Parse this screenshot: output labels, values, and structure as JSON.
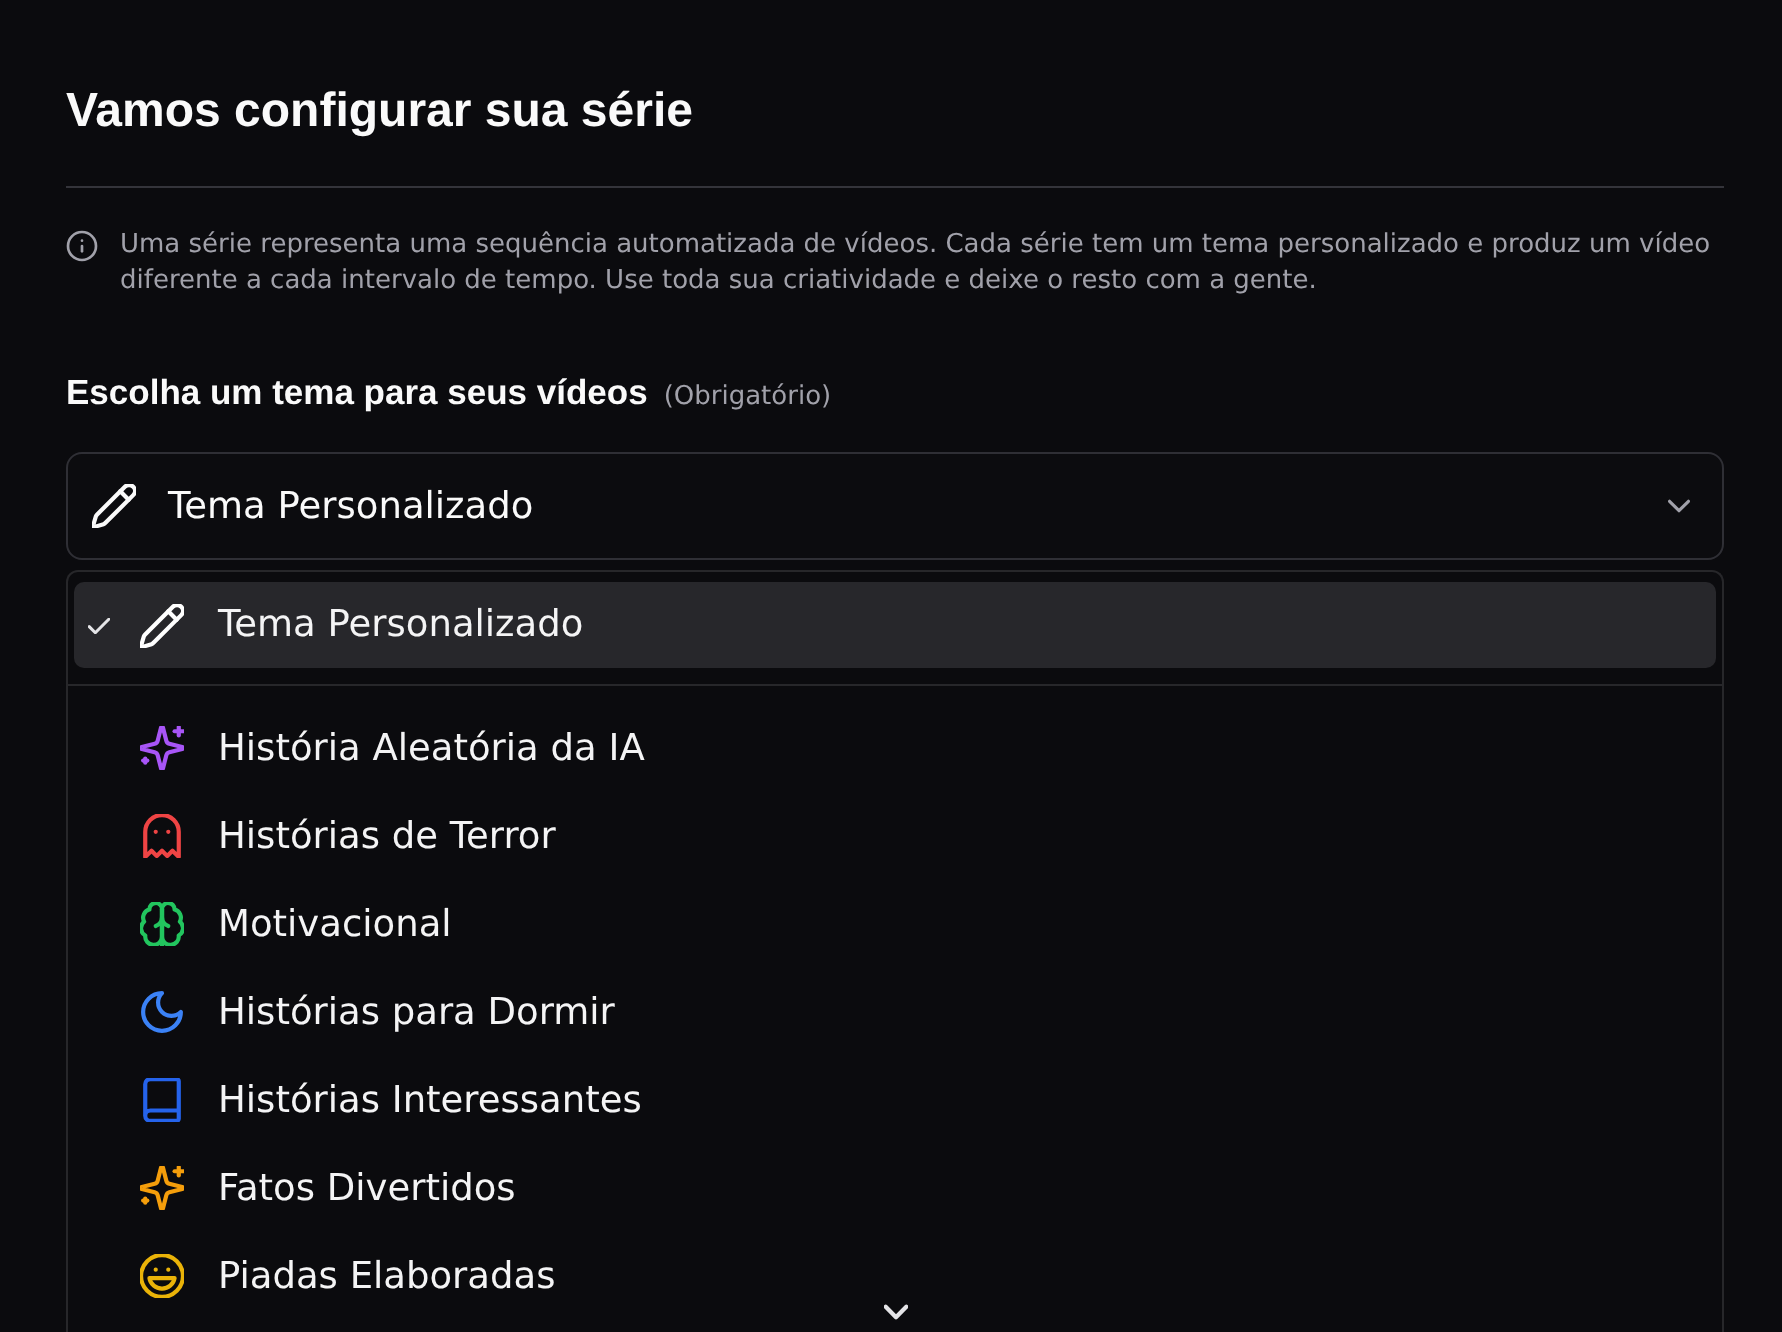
{
  "heading": {
    "title": "Vamos configurar sua série"
  },
  "info": {
    "text": "Uma série representa uma sequência automatizada de vídeos. Cada série tem um tema personalizado e produz um vídeo diferente a cada intervalo de tempo. Use toda sua criatividade e deixe o resto com a gente."
  },
  "theme_field": {
    "label": "Escolha um tema para seus vídeos",
    "required_note": "(Obrigatório)",
    "value": "Tema Personalizado",
    "expanded": true
  },
  "dropdown": {
    "groups": [
      {
        "options": [
          {
            "label": "Tema Personalizado",
            "kind": "pencil",
            "color": "#ffffff",
            "selected": true
          }
        ]
      },
      {
        "options": [
          {
            "label": "História Aleatória da IA",
            "kind": "sparkles",
            "color": "#a855f7",
            "selected": false
          },
          {
            "label": "Histórias de Terror",
            "kind": "ghost",
            "color": "#ef4444",
            "selected": false
          },
          {
            "label": "Motivacional",
            "kind": "brain",
            "color": "#22c55e",
            "selected": false
          },
          {
            "label": "Histórias para Dormir",
            "kind": "moon",
            "color": "#3b82f6",
            "selected": false
          },
          {
            "label": "Histórias Interessantes",
            "kind": "book",
            "color": "#2563eb",
            "selected": false
          },
          {
            "label": "Fatos Divertidos",
            "kind": "sparkles",
            "color": "#f59e0b",
            "selected": false
          },
          {
            "label": "Piadas Elaboradas",
            "kind": "laugh",
            "color": "#eab308",
            "selected": false
          }
        ]
      }
    ]
  }
}
